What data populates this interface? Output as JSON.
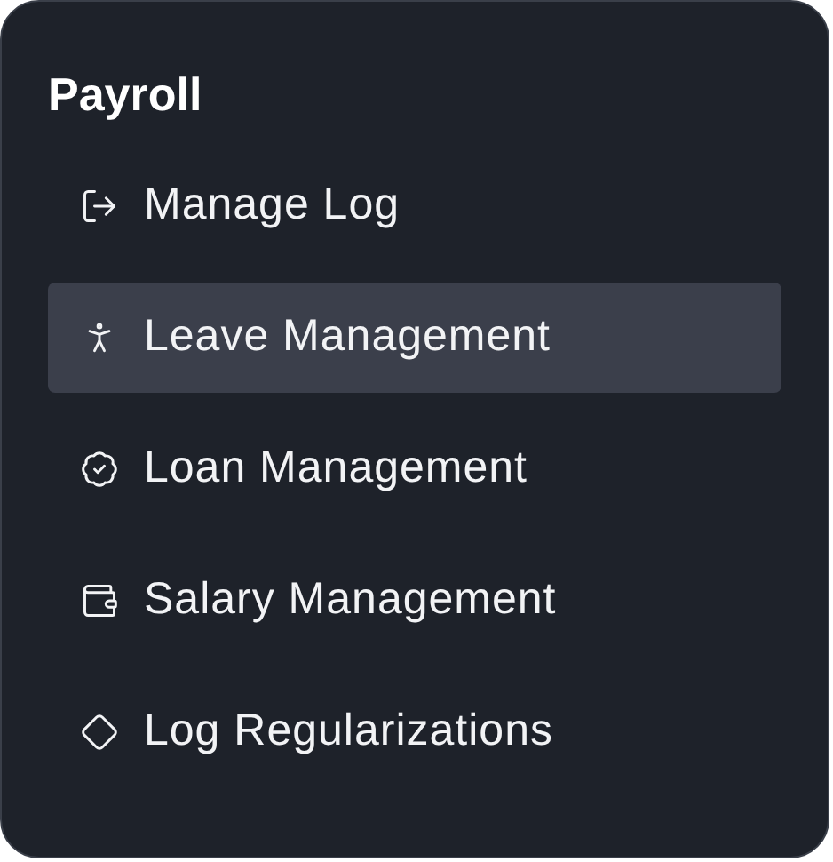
{
  "title": "Payroll",
  "items": [
    {
      "label": "Manage Log",
      "selected": false
    },
    {
      "label": "Leave Management",
      "selected": true
    },
    {
      "label": "Loan Management",
      "selected": false
    },
    {
      "label": "Salary Management",
      "selected": false
    },
    {
      "label": "Log Regularizations",
      "selected": false
    }
  ]
}
